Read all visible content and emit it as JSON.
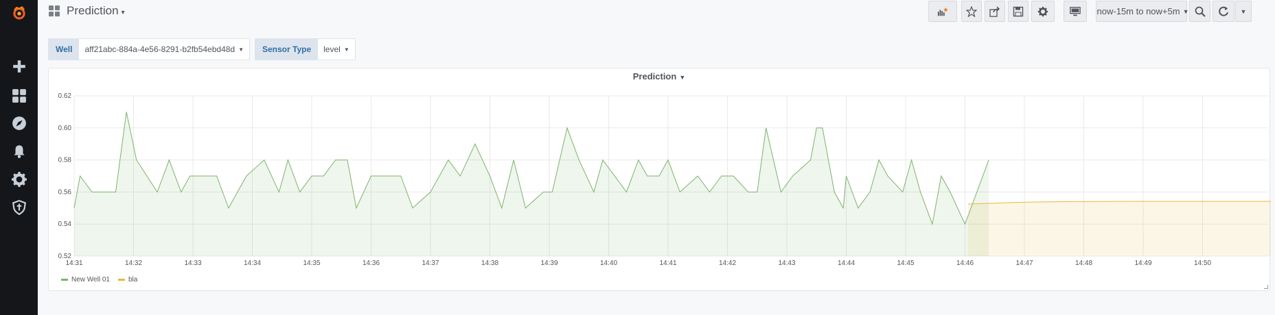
{
  "sidebar": {
    "items": [
      {
        "name": "grafana-logo",
        "icon": "grafana-logo"
      },
      {
        "name": "create-icon",
        "icon": "plus"
      },
      {
        "name": "dashboards-icon",
        "icon": "grid"
      },
      {
        "name": "explore-icon",
        "icon": "compass"
      },
      {
        "name": "alerting-icon",
        "icon": "bell"
      },
      {
        "name": "configuration-icon",
        "icon": "gear"
      },
      {
        "name": "server-admin-icon",
        "icon": "shield"
      }
    ]
  },
  "header": {
    "title": "Prediction",
    "title_caret": "▾",
    "time_range": "now-15m to now+5m"
  },
  "variables": [
    {
      "label": "Well",
      "value": "aff21abc-884a-4e56-8291-b2fb54ebd48d"
    },
    {
      "label": "Sensor Type",
      "value": "level"
    }
  ],
  "panel": {
    "title": "Prediction",
    "legend": [
      {
        "name": "New Well 01",
        "color": "#7eb26d"
      },
      {
        "name": "bla",
        "color": "#eab839"
      }
    ]
  },
  "chart_data": {
    "type": "area",
    "title": "Prediction",
    "ylim": [
      0.52,
      0.62
    ],
    "y_ticks": [
      "0.52",
      "0.54",
      "0.56",
      "0.58",
      "0.60",
      "0.62"
    ],
    "x_ticks": [
      "14:31",
      "14:32",
      "14:33",
      "14:34",
      "14:35",
      "14:36",
      "14:37",
      "14:38",
      "14:39",
      "14:40",
      "14:41",
      "14:42",
      "14:43",
      "14:44",
      "14:45",
      "14:46",
      "14:47",
      "14:48",
      "14:49",
      "14:50"
    ],
    "xlim_minutes": [
      0,
      20.65
    ],
    "grid": true,
    "legend_position": "bottom-left",
    "series": [
      {
        "name": "New Well 01",
        "color": "#7eb26d",
        "x": [
          0,
          0.1,
          0.3,
          0.5,
          0.7,
          0.88,
          1.05,
          1.4,
          1.6,
          1.8,
          1.95,
          2.2,
          2.4,
          2.6,
          2.75,
          2.9,
          3.2,
          3.45,
          3.6,
          3.8,
          4.0,
          4.2,
          4.4,
          4.6,
          4.75,
          5.0,
          5.25,
          5.5,
          5.7,
          6.0,
          6.3,
          6.5,
          6.75,
          7.0,
          7.2,
          7.4,
          7.6,
          7.9,
          8.05,
          8.3,
          8.5,
          8.75,
          8.9,
          9.3,
          9.5,
          9.65,
          9.85,
          10.0,
          10.2,
          10.5,
          10.7,
          10.9,
          11.1,
          11.35,
          11.5,
          11.65,
          11.9,
          12.1,
          12.4,
          12.5,
          12.6,
          12.8,
          12.95,
          13.0,
          13.2,
          13.4,
          13.55,
          13.7,
          13.95,
          14.1,
          14.25,
          14.45,
          14.6,
          14.75,
          15.0,
          15.2,
          15.4
        ],
        "y": [
          0.55,
          0.57,
          0.56,
          0.56,
          0.56,
          0.61,
          0.58,
          0.56,
          0.58,
          0.56,
          0.57,
          0.57,
          0.57,
          0.55,
          0.56,
          0.57,
          0.58,
          0.56,
          0.58,
          0.56,
          0.57,
          0.57,
          0.58,
          0.58,
          0.55,
          0.57,
          0.57,
          0.57,
          0.55,
          0.56,
          0.58,
          0.57,
          0.59,
          0.57,
          0.55,
          0.58,
          0.55,
          0.56,
          0.56,
          0.6,
          0.58,
          0.56,
          0.58,
          0.56,
          0.58,
          0.57,
          0.57,
          0.58,
          0.56,
          0.57,
          0.56,
          0.57,
          0.57,
          0.56,
          0.56,
          0.6,
          0.56,
          0.57,
          0.58,
          0.6,
          0.6,
          0.56,
          0.55,
          0.57,
          0.55,
          0.56,
          0.58,
          0.57,
          0.56,
          0.58,
          0.56,
          0.54,
          0.57,
          0.56,
          0.54,
          0.56,
          0.58
        ]
      },
      {
        "name": "bla",
        "color": "#eab839",
        "x": [
          15.05,
          15.3,
          15.55,
          15.8,
          16.1,
          16.4,
          16.8,
          17.3,
          17.8,
          18.4,
          19.0,
          19.6,
          20.2,
          20.5
        ],
        "y": [
          0.5525,
          0.5528,
          0.5531,
          0.5534,
          0.5537,
          0.5539,
          0.554,
          0.5541,
          0.5542,
          0.5542,
          0.5542,
          0.5542,
          0.5542,
          0.5542
        ]
      }
    ]
  }
}
